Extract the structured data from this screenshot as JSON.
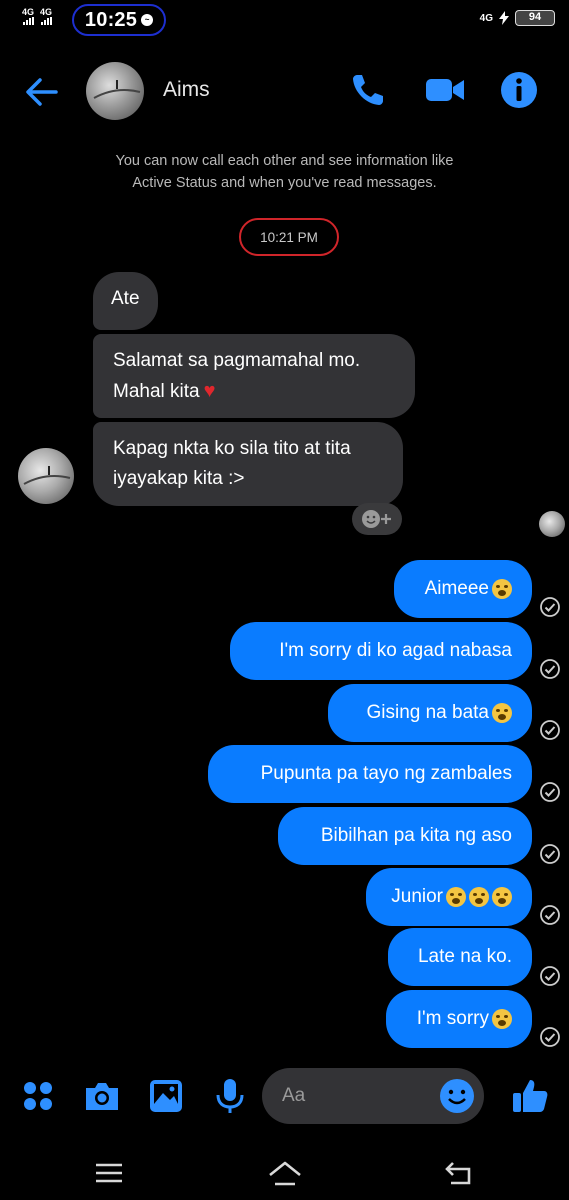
{
  "status_bar": {
    "network_left_1": "4G",
    "network_left_2": "4G",
    "time": "10:25",
    "network_right": "4G",
    "battery": "94"
  },
  "header": {
    "contact_name": "Aims",
    "icons": [
      "back-arrow-icon",
      "phone-icon",
      "video-camera-icon",
      "info-icon"
    ]
  },
  "conversation": {
    "notice_line1": "You can now call each other and see information like",
    "notice_line2": "Active Status and when you've read messages.",
    "timestamp": "10:21 PM",
    "incoming": [
      {
        "text": "Ate"
      },
      {
        "line1": "Salamat sa pagmamahal mo.",
        "line2": "Mahal kita"
      },
      {
        "line1": "Kapag nkta ko sila tito at tita",
        "line2": "iyayakap kita :>"
      }
    ],
    "outgoing": [
      {
        "text": "Aimeee"
      },
      {
        "text": "I'm sorry di ko agad nabasa"
      },
      {
        "text": "Gising na bata"
      },
      {
        "text": "Pupunta pa tayo ng zambales"
      },
      {
        "text": "Bibilhan pa kita ng aso"
      },
      {
        "text": "Junior"
      },
      {
        "text": "Late na ko."
      },
      {
        "text": "I'm sorry"
      }
    ]
  },
  "composer": {
    "placeholder": "Aa",
    "icons": [
      "apps-grid-icon",
      "camera-icon",
      "gallery-icon",
      "microphone-icon",
      "emoji-icon",
      "thumbs-up-icon"
    ]
  },
  "colors": {
    "accent": "#0a7cff",
    "incoming_bubble": "#333336",
    "background": "#000000"
  }
}
